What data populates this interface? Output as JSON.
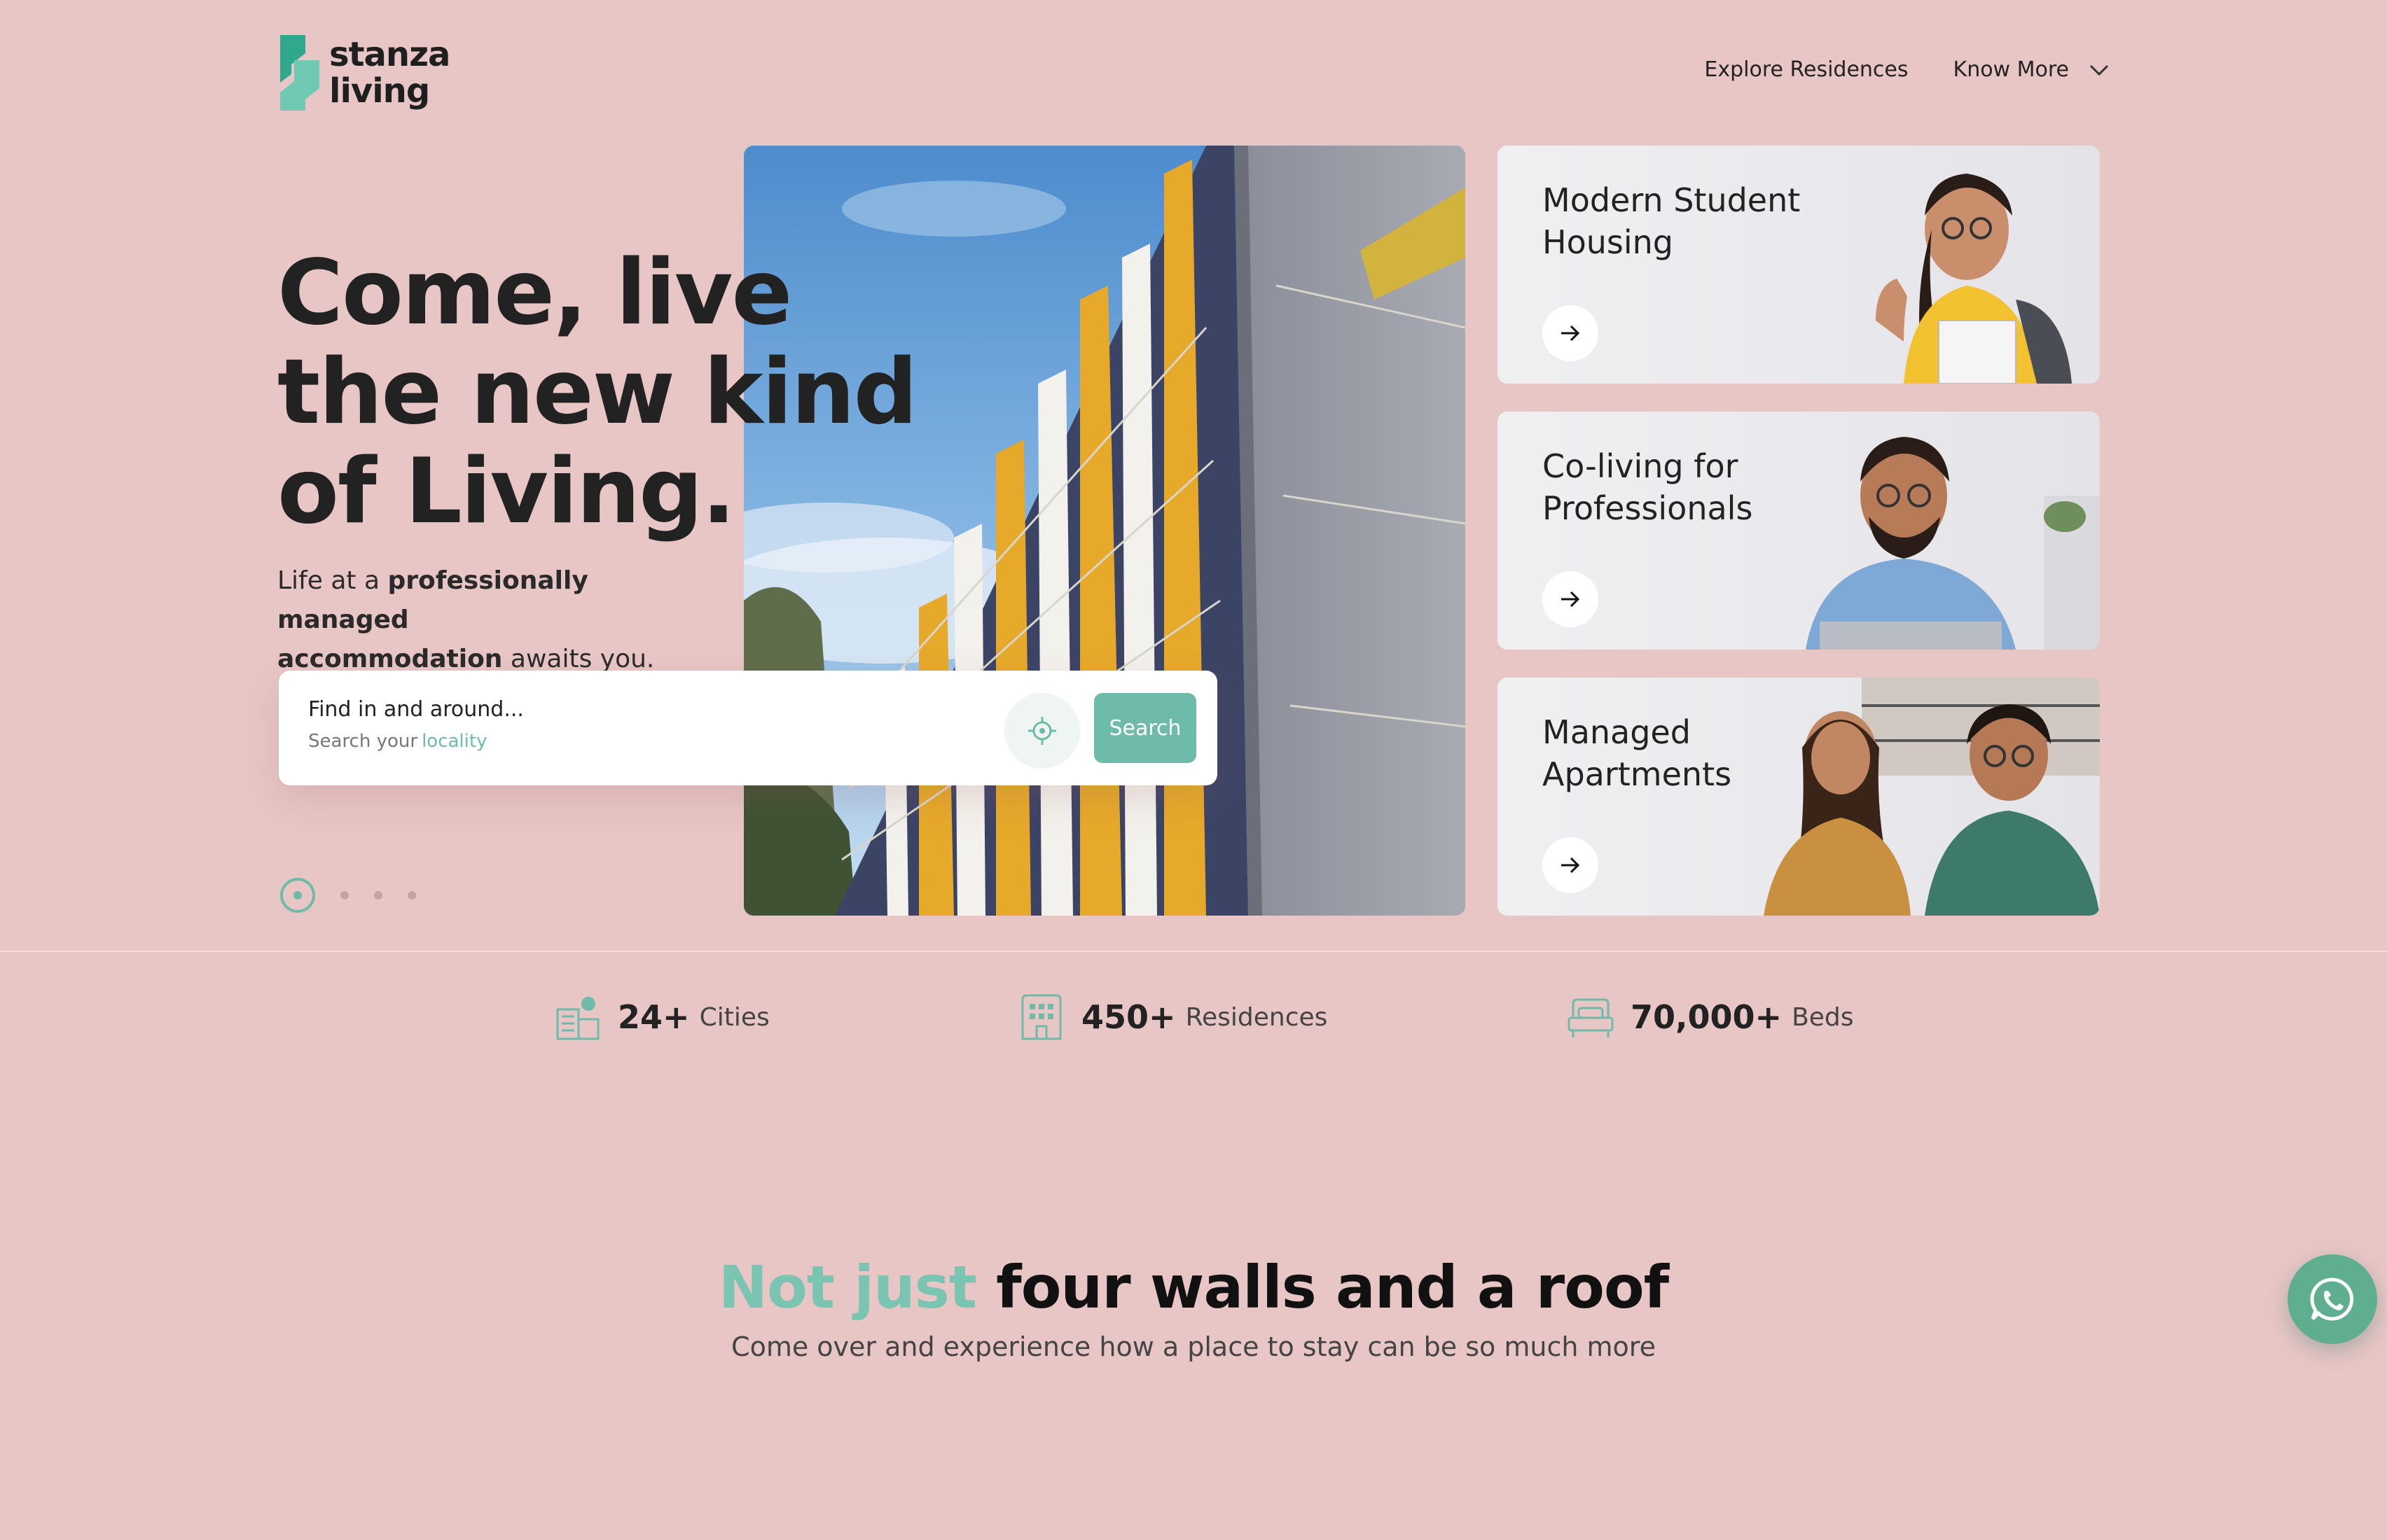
{
  "brand": {
    "line1": "stanza",
    "line2": "living"
  },
  "nav": {
    "explore": "Explore Residences",
    "know_more": "Know More"
  },
  "hero": {
    "title_lines": [
      "Come, live",
      "the new kind",
      "of Living."
    ],
    "sub_pre": "Life at a ",
    "sub_bold1": "professionally managed",
    "sub_bold2": "accommodation",
    "sub_post": " awaits you."
  },
  "search": {
    "heading": "Find in and around...",
    "hint": "Search your",
    "hint_accent": "locality",
    "button": "Search"
  },
  "cards": [
    {
      "title": "Modern Student Housing"
    },
    {
      "title": "Co-living for Professionals"
    },
    {
      "title": "Managed Apartments"
    }
  ],
  "carousel": {
    "total_slides": 4,
    "active_slide": 1
  },
  "stats": [
    {
      "number": "24+",
      "label": "Cities",
      "icon": "city-icon"
    },
    {
      "number": "450+",
      "label": "Residences",
      "icon": "building-icon"
    },
    {
      "number": "70,000+",
      "label": "Beds",
      "icon": "bed-icon"
    }
  ],
  "section": {
    "title_accent": "Not just",
    "title_rest": " four walls and a roof",
    "subtitle": "Come over and experience how a place to stay can be so much more"
  },
  "colors": {
    "background": "#e8c6c6",
    "accent": "#6fbba9",
    "text": "#222222"
  }
}
